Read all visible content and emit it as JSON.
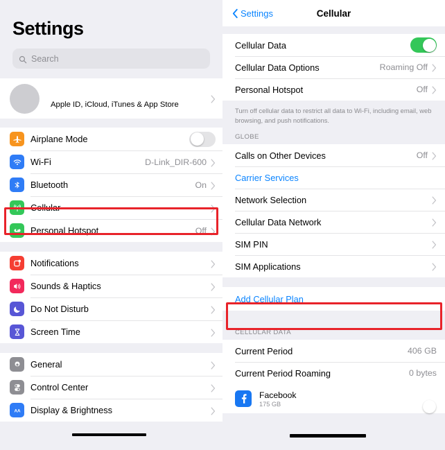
{
  "left_panel": {
    "title": "Settings",
    "search": {
      "placeholder": "Search",
      "icon": "search-icon"
    },
    "profile": {
      "label": "Apple ID, iCloud, iTunes & App Store",
      "icon": "avatar"
    },
    "groups": [
      {
        "items": [
          {
            "label": "Airplane Mode",
            "icon": "airplane-icon",
            "icon_color": "#f7941e",
            "control": "toggle",
            "toggle_on": false
          },
          {
            "label": "Wi-Fi",
            "icon": "wifi-icon",
            "icon_color": "#2f7cf6",
            "value": "D-Link_DIR-600",
            "control": "chevron"
          },
          {
            "label": "Bluetooth",
            "icon": "bluetooth-icon",
            "icon_color": "#2f7cf6",
            "value": "On",
            "control": "chevron"
          },
          {
            "label": "Cellular",
            "icon": "cellular-icon",
            "icon_color": "#34c759",
            "value": "",
            "control": "chevron",
            "highlighted": true
          },
          {
            "label": "Personal Hotspot",
            "icon": "hotspot-icon",
            "icon_color": "#34c759",
            "value": "Off",
            "control": "chevron"
          }
        ]
      },
      {
        "items": [
          {
            "label": "Notifications",
            "icon": "notifications-icon",
            "icon_color": "#f53e32",
            "control": "chevron"
          },
          {
            "label": "Sounds & Haptics",
            "icon": "sounds-icon",
            "icon_color": "#f2295b",
            "control": "chevron"
          },
          {
            "label": "Do Not Disturb",
            "icon": "moon-icon",
            "icon_color": "#5856d6",
            "control": "chevron"
          },
          {
            "label": "Screen Time",
            "icon": "hourglass-icon",
            "icon_color": "#5856d6",
            "control": "chevron"
          }
        ]
      },
      {
        "items": [
          {
            "label": "General",
            "icon": "gear-icon",
            "icon_color": "#8e8e93",
            "control": "chevron"
          },
          {
            "label": "Control Center",
            "icon": "control-center-icon",
            "icon_color": "#8e8e93",
            "control": "chevron"
          },
          {
            "label": "Display & Brightness",
            "icon": "display-brightness-icon",
            "icon_color": "#2f7cf6",
            "control": "chevron",
            "redacted": true
          }
        ]
      }
    ]
  },
  "right_panel": {
    "nav": {
      "back_label": "Settings",
      "title": "Cellular",
      "back_icon": "chevron-left-icon"
    },
    "section_top": [
      {
        "label": "Cellular Data",
        "control": "toggle",
        "toggle_on": true
      },
      {
        "label": "Cellular Data Options",
        "value": "Roaming Off",
        "control": "chevron"
      },
      {
        "label": "Personal Hotspot",
        "value": "Off",
        "control": "chevron"
      }
    ],
    "footnote": "Turn off cellular data to restrict all data to Wi-Fi, including email, web browsing, and push notifications.",
    "carrier_header": "GLOBE",
    "section_carrier": [
      {
        "label": "Calls on Other Devices",
        "value": "Off",
        "control": "chevron"
      },
      {
        "label": "Carrier Services",
        "control": "link",
        "is_link": true
      },
      {
        "label": "Network Selection",
        "control": "chevron"
      },
      {
        "label": "Cellular Data Network",
        "control": "chevron"
      },
      {
        "label": "SIM PIN",
        "control": "chevron"
      },
      {
        "label": "SIM Applications",
        "control": "chevron"
      }
    ],
    "add_plan": {
      "label": "Add Cellular Plan",
      "is_link": true,
      "highlighted": true
    },
    "data_header": "CELLULAR DATA",
    "section_data": [
      {
        "label": "Current Period",
        "value": "406 GB",
        "control": "none"
      },
      {
        "label": "Current Period Roaming",
        "value": "0 bytes",
        "control": "none"
      }
    ],
    "app_row": {
      "name": "Facebook",
      "size": "175 GB",
      "icon": "facebook-icon",
      "icon_color": "#3b5998",
      "toggle_on": true,
      "redacted": true
    }
  },
  "annotations": {
    "highlight_color": "#e8232a",
    "redaction_color": "#000000"
  }
}
